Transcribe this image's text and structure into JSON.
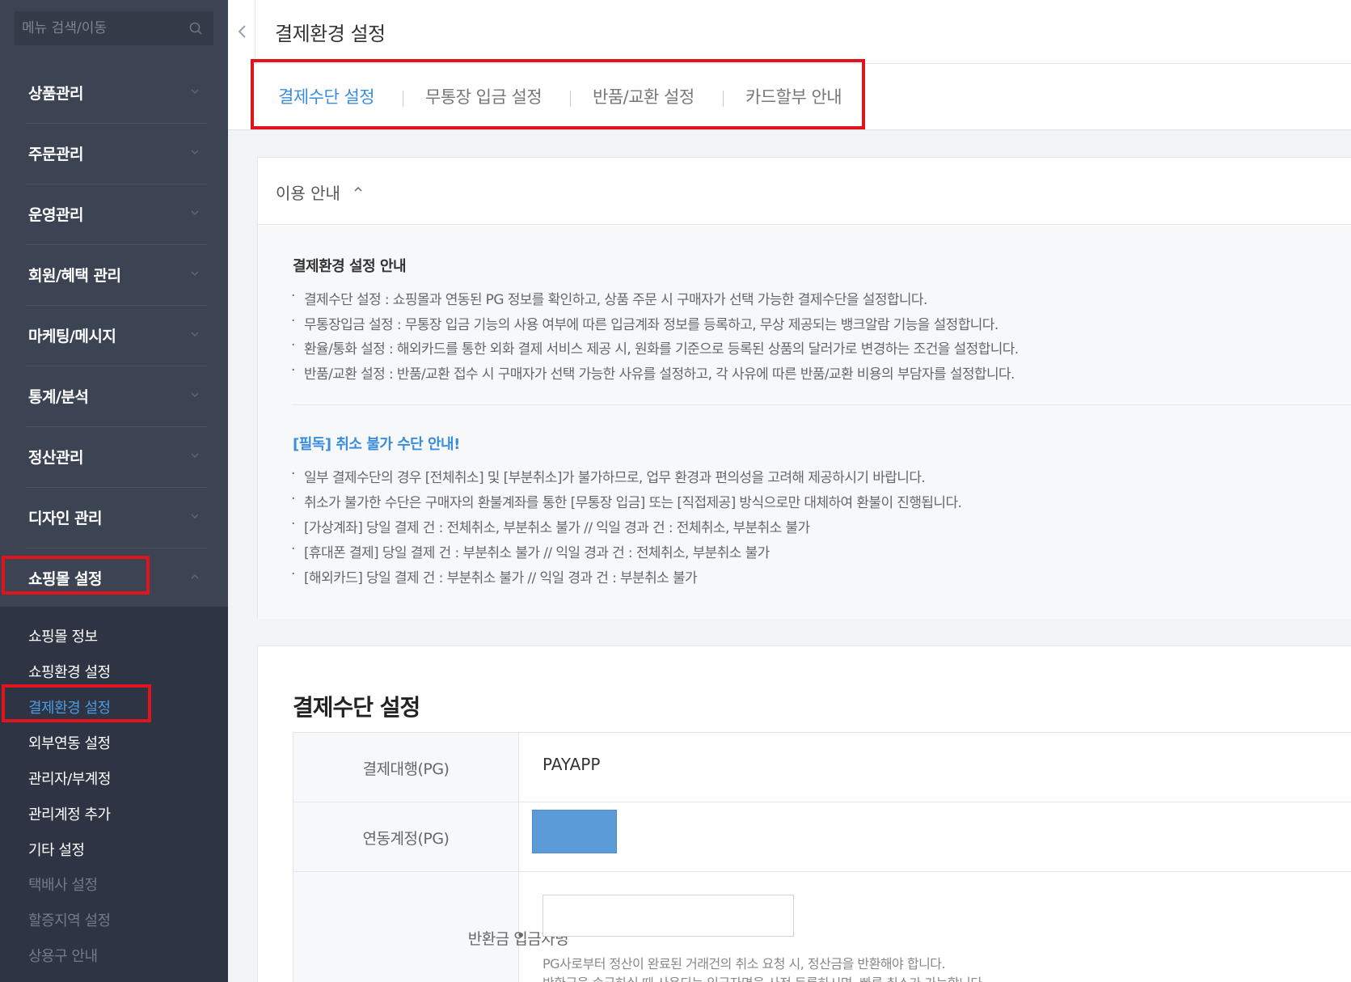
{
  "sidebar": {
    "search_placeholder": "메뉴 검색/이동",
    "menu": [
      {
        "label": "상품관리"
      },
      {
        "label": "주문관리"
      },
      {
        "label": "운영관리"
      },
      {
        "label": "회원/혜택 관리"
      },
      {
        "label": "마케팅/메시지"
      },
      {
        "label": "통계/분석"
      },
      {
        "label": "정산관리"
      },
      {
        "label": "디자인 관리"
      },
      {
        "label": "쇼핑몰 설정",
        "expanded": true
      }
    ],
    "submenu": [
      {
        "label": "쇼핑몰 정보",
        "state": "normal"
      },
      {
        "label": "쇼핑환경 설정",
        "state": "normal"
      },
      {
        "label": "결제환경 설정",
        "state": "active"
      },
      {
        "label": "외부연동 설정",
        "state": "normal"
      },
      {
        "label": "관리자/부계정",
        "state": "normal"
      },
      {
        "label": "관리계정 추가",
        "state": "normal"
      },
      {
        "label": "기타 설정",
        "state": "normal"
      },
      {
        "label": "택배사 설정",
        "state": "disabled"
      },
      {
        "label": "할증지역 설정",
        "state": "disabled"
      },
      {
        "label": "상용구 안내",
        "state": "disabled"
      }
    ]
  },
  "header": {
    "title": "결제환경 설정"
  },
  "tabs": [
    {
      "label": "결제수단 설정",
      "active": true
    },
    {
      "label": "무통장 입금 설정"
    },
    {
      "label": "반품/교환 설정"
    },
    {
      "label": "카드할부 안내"
    }
  ],
  "info": {
    "toggle_label": "이용 안내",
    "section1": {
      "title": "결제환경 설정 안내",
      "lines": [
        "결제수단 설정 : 쇼핑몰과 연동된 PG 정보를 확인하고, 상품 주문 시 구매자가 선택 가능한 결제수단을 설정합니다.",
        "무통장입금 설정 : 무통장 입금 기능의 사용 여부에 따른 입금계좌 정보를 등록하고, 무상 제공되는 뱅크알람 기능을 설정합니다.",
        "환율/통화 설정 : 해외카드를 통한 외화 결제 서비스 제공 시, 원화를 기준으로 등록된 상품의 달러가로 변경하는 조건을 설정합니다.",
        "반품/교환 설정 : 반품/교환 접수 시 구매자가 선택 가능한 사유를 설정하고, 각 사유에 따른 반품/교환 비용의 부담자를 설정합니다."
      ]
    },
    "section2": {
      "title": "[필독] 취소 불가 수단 안내!",
      "lines": [
        "일부 결제수단의 경우 [전체취소] 및 [부분취소]가 불가하므로, 업무 환경과 편의성을 고려해 제공하시기 바랍니다.",
        "취소가 불가한 수단은 구매자의 환불계좌를 통한 [무통장 입금] 또는 [직접제공] 방식으로만 대체하여 환불이 진행됩니다.",
        "[가상계좌] 당일 결제 건 : 전체취소, 부분취소 불가 // 익일 경과 건 : 전체취소, 부분취소 불가",
        "[휴대폰 결제] 당일 결제 건 : 부분취소 불가 // 익일 경과 건 : 전체취소, 부분취소 불가",
        "[해외카드] 당일 결제 건 : 부분취소 불가 // 익일 경과 건 : 부분취소 불가"
      ]
    }
  },
  "payment": {
    "title": "결제수단 설정",
    "rows": {
      "pg": {
        "label": "결제대행(PG)",
        "value": "PAYAPP"
      },
      "account": {
        "label": "연동계정(PG)"
      },
      "refund": {
        "label": "반환금 입금자명",
        "required_mark": "•",
        "input_value": "",
        "help": [
          "PG사로부터 정산이 완료된 거래건의 취소 요청 시, 정산금을 반환해야 합니다.",
          "반환금을 송금하실 때 사용되는 입금자명을 사전 등록하시면, 빠른 취소가 가능합니다."
        ]
      }
    }
  }
}
